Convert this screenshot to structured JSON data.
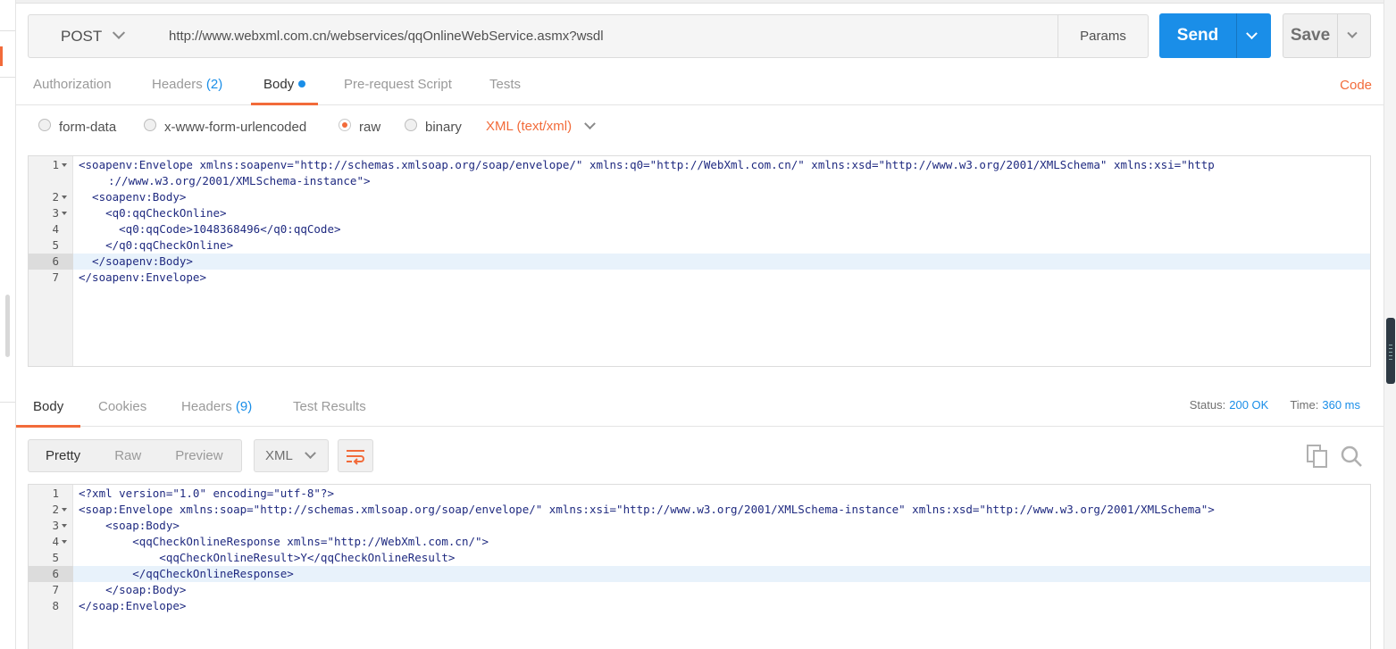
{
  "request": {
    "method": "POST",
    "url": "http://www.webxml.com.cn/webservices/qqOnlineWebService.asmx?wsdl",
    "params_label": "Params",
    "send_label": "Send",
    "save_label": "Save"
  },
  "request_tabs": [
    {
      "label": "Authorization"
    },
    {
      "label": "Headers",
      "count": "(2)"
    },
    {
      "label": "Body"
    },
    {
      "label": "Pre-request Script"
    },
    {
      "label": "Tests"
    }
  ],
  "code_label": "Code",
  "body_types": [
    {
      "label": "form-data"
    },
    {
      "label": "x-www-form-urlencoded"
    },
    {
      "label": "raw"
    },
    {
      "label": "binary"
    }
  ],
  "body_language": "XML (text/xml)",
  "request_body_lines": [
    {
      "num": "1",
      "text": "<soapenv:Envelope xmlns:soapenv=\"http://schemas.xmlsoap.org/soap/envelope/\" xmlns:q0=\"http://WebXml.com.cn/\" xmlns:xsd=\"http://www.w3.org/2001/XMLSchema\" xmlns:xsi=\"http"
    },
    {
      "num": "",
      "text": "://www.w3.org/2001/XMLSchema-instance\">"
    },
    {
      "num": "2",
      "text": "  <soapenv:Body>"
    },
    {
      "num": "3",
      "text": "    <q0:qqCheckOnline>"
    },
    {
      "num": "4",
      "text": "      <q0:qqCode>1048368496</q0:qqCode>"
    },
    {
      "num": "5",
      "text": "    </q0:qqCheckOnline>"
    },
    {
      "num": "6",
      "text": "  </soapenv:Body>"
    },
    {
      "num": "7",
      "text": "</soapenv:Envelope>"
    }
  ],
  "response_tabs": [
    {
      "label": "Body"
    },
    {
      "label": "Cookies"
    },
    {
      "label": "Headers",
      "count": "(9)"
    },
    {
      "label": "Test Results"
    }
  ],
  "status": {
    "status_label": "Status:",
    "status_value": "200 OK",
    "time_label": "Time:",
    "time_value": "360 ms"
  },
  "view_modes": [
    {
      "label": "Pretty"
    },
    {
      "label": "Raw"
    },
    {
      "label": "Preview"
    }
  ],
  "response_format": "XML",
  "response_body_lines": [
    {
      "num": "1",
      "text": "<?xml version=\"1.0\" encoding=\"utf-8\"?>"
    },
    {
      "num": "2",
      "text": "<soap:Envelope xmlns:soap=\"http://schemas.xmlsoap.org/soap/envelope/\" xmlns:xsi=\"http://www.w3.org/2001/XMLSchema-instance\" xmlns:xsd=\"http://www.w3.org/2001/XMLSchema\">"
    },
    {
      "num": "3",
      "text": "    <soap:Body>"
    },
    {
      "num": "4",
      "text": "        <qqCheckOnlineResponse xmlns=\"http://WebXml.com.cn/\">"
    },
    {
      "num": "5",
      "text": "            <qqCheckOnlineResult>Y</qqCheckOnlineResult>"
    },
    {
      "num": "6",
      "text": "        </qqCheckOnlineResponse>"
    },
    {
      "num": "7",
      "text": "    </soap:Body>"
    },
    {
      "num": "8",
      "text": "</soap:Envelope>"
    }
  ],
  "colors": {
    "accent": "#f26b3a",
    "primary": "#1a8ee8"
  }
}
